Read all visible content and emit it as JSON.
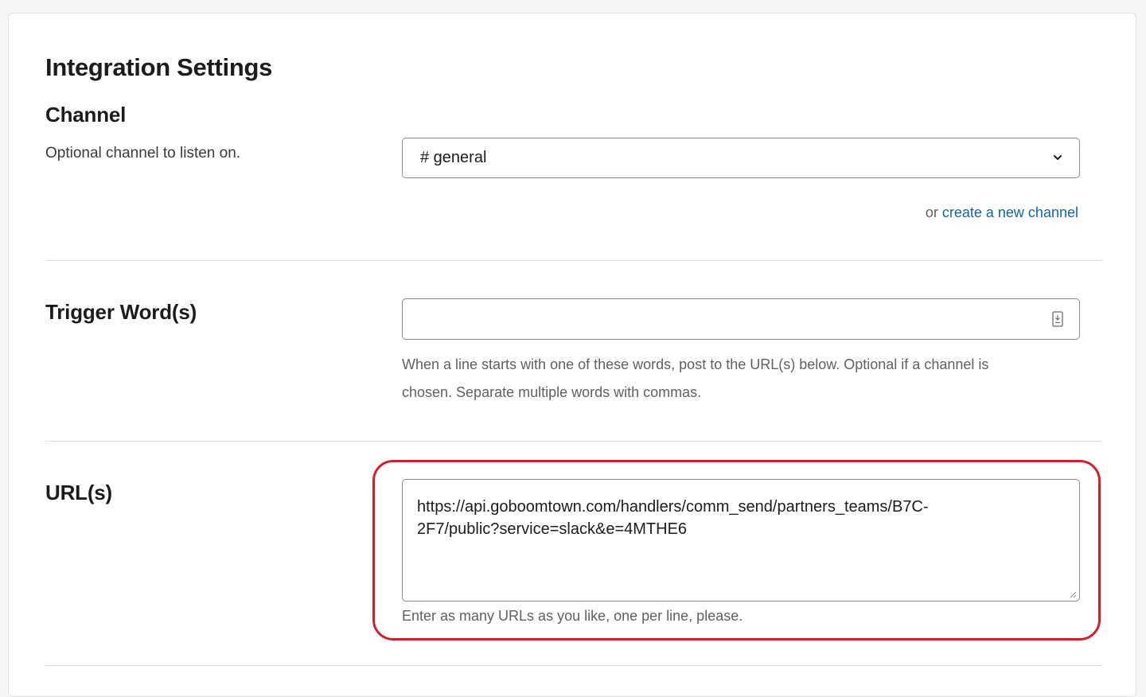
{
  "integration_settings": {
    "title": "Integration Settings"
  },
  "channel": {
    "heading": "Channel",
    "description": "Optional channel to listen on.",
    "selected_value": "# general",
    "dropdown_icon": "chevron-down-icon",
    "link_prefix": "or",
    "link_label": "create a new channel"
  },
  "trigger_words": {
    "heading": "Trigger Word(s)",
    "value": "",
    "field_icon": "autofill-icon",
    "help_line1": "When a line starts with one of these words, post to the URL(s) below. Optional if a channel is",
    "help_line2": "chosen. Separate multiple words with commas."
  },
  "urls": {
    "heading": "URL(s)",
    "value_line1": "https://api.goboomtown.com/handlers/comm_send/partners_teams/B7C-",
    "value_line2": "2F7/public?service=slack&e=4MTHE6",
    "help_text": "Enter as many URLs as you like, one per line, please.",
    "resize_icon": "resize-handle-icon"
  },
  "colors": {
    "link": "#1264a3",
    "highlight": "#d0202d",
    "help_text": "#616061"
  }
}
